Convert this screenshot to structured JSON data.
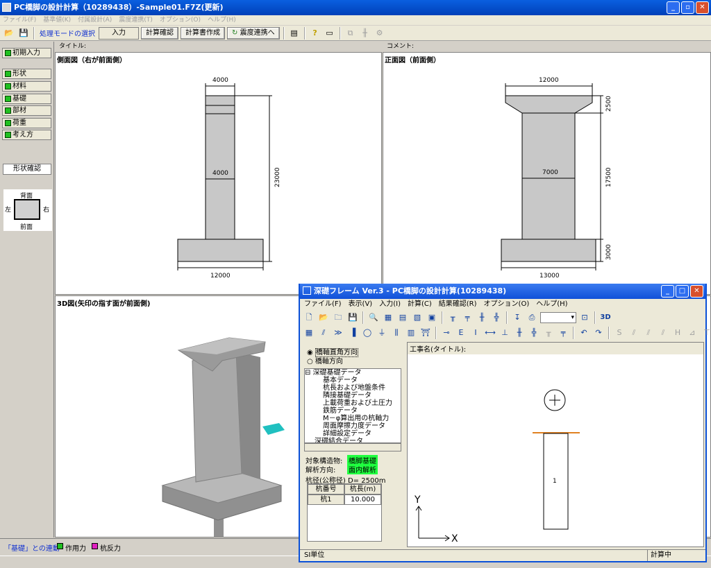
{
  "window": {
    "title": "PC橋脚の設計計算（10289438）-Sample01.F7Z(更新)"
  },
  "menu": [
    "ファイル(F)",
    "基準値(K)",
    "付属設計(A)",
    "震度連携(T)",
    "オプション(O)",
    "ヘルプ(H)"
  ],
  "toolbar": {
    "mode_label": "処理モードの選択",
    "mode_value": "入力",
    "calc_check": "計算確認",
    "report": "計算書作成",
    "seismic": "震度連携へ"
  },
  "sidebar": {
    "items": [
      {
        "label": "初期入力"
      },
      {
        "label": "形状"
      },
      {
        "label": "材料"
      },
      {
        "label": "基礎"
      },
      {
        "label": "部材"
      },
      {
        "label": "荷重"
      },
      {
        "label": "考え方"
      }
    ],
    "shape_confirm": "形状確認",
    "orient_back": "背面",
    "orient_front": "前面",
    "orient_left": "左",
    "orient_right": "右"
  },
  "header": {
    "title_label": "タイトル:",
    "comment_label": "コメント:"
  },
  "views": {
    "side_title": "側面図（右が前面側）",
    "front_title": "正面図（前面側）",
    "view3d_title": "3D図(矢印の指す面が前面側)"
  },
  "side_dims": {
    "top": "4000",
    "mid": "4000",
    "height": "23000",
    "base": "12000"
  },
  "front_dims": {
    "top": "12000",
    "mid": "7000",
    "h1": "2500",
    "h2": "17500",
    "h3": "3000",
    "base": "13000"
  },
  "statusbar": {
    "link_label": "「基礎」との連動",
    "legend_action": "作用力",
    "legend_reaction": "杭反力"
  },
  "colors": {
    "accent": "#1030d0",
    "legend_action": "#20c020",
    "legend_reaction": "#e020c0",
    "highlight": "#20ff40"
  },
  "child": {
    "title": "深礎フレーム Ver.3 - PC橋脚の設計計算(10289438)",
    "menu": [
      "ファイル(F)",
      "表示(V)",
      "入力(I)",
      "計算(C)",
      "結果確認(R)",
      "オプション(O)",
      "ヘルプ(H)"
    ],
    "radio1": "橋軸直角方向",
    "radio2": "橋軸方向",
    "tree": {
      "root": "深礎基礎データ",
      "items": [
        "基本データ",
        "杭長および地盤条件",
        "隣接基礎データ",
        "上載荷重および土圧力",
        "鉄筋データ",
        "M－φ算出用の杭軸力",
        "周面摩擦力度データ",
        "詳細設定データ"
      ],
      "next": "深礎結合データ"
    },
    "target_label": "対象構造物:",
    "target_value": "橋脚基礎",
    "analysis_label": "解析方向:",
    "analysis_value": "面内解析",
    "pile_dia": "杭径(公称径) D= 2500m",
    "table": {
      "headers": [
        "杭番号",
        "杭長(m)"
      ],
      "rows": [
        [
          "杭1",
          "10.000"
        ]
      ]
    },
    "work_title": "工事名(タイトル):",
    "pile_label": "1",
    "axis_y": "Y",
    "axis_x": "X",
    "status_unit": "SI単位",
    "status_calc": "計算中"
  }
}
